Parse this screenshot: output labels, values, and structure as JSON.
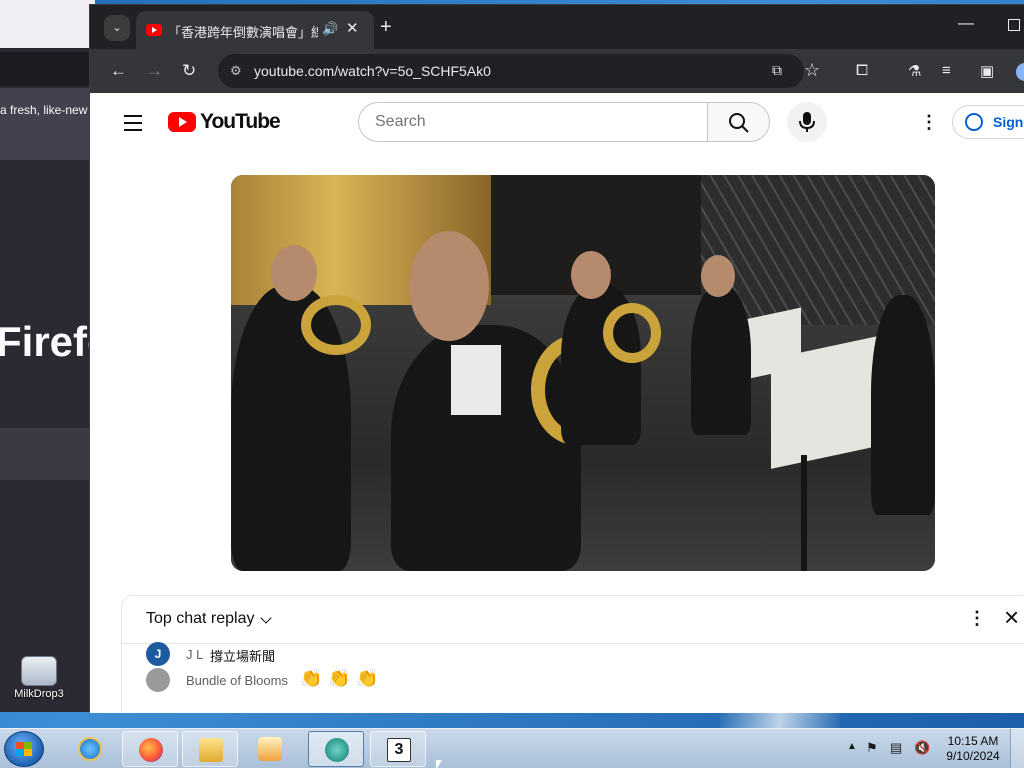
{
  "browser": {
    "tab_title": "「香港跨年倒數演唱會」線上",
    "url": "youtube.com/watch?v=5o_SCHF5Ak0",
    "tab_search_icon": "chevron-down-icon",
    "new_tab_label": "+",
    "close_tab_label": "✕",
    "audio_icon": "speaker-icon"
  },
  "youtube": {
    "logo_text": "YouTube",
    "search_placeholder": "Search",
    "sign_in_label": "Sign"
  },
  "chat": {
    "title": "Top chat replay",
    "messages": [
      {
        "initial": "J",
        "author": "J L",
        "text": "撐立場新聞",
        "avatar_color": "#1e5aa0"
      },
      {
        "initial": "",
        "author": "Bundle of Blooms",
        "text": "",
        "avatar_color": "#9a9a9a"
      }
    ]
  },
  "background_window": {
    "notification_text": "a fresh, like-new",
    "brand_text": "Firefo"
  },
  "desktop": {
    "icon_label": "MilkDrop3"
  },
  "taskbar": {
    "time": "10:15 AM",
    "date": "9/10/2024",
    "apps": [
      "internet-explorer",
      "firefox",
      "file-explorer",
      "media-player",
      "chat-app",
      "notepad-3"
    ]
  }
}
